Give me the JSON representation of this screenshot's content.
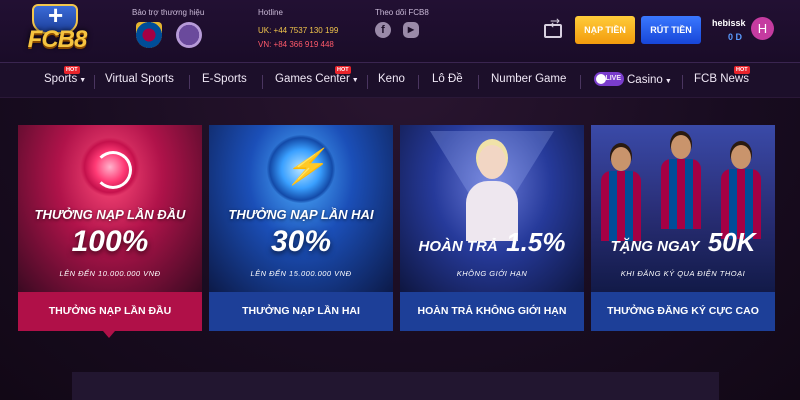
{
  "header": {
    "logo_text": "FCB8",
    "sponsor_label": "Bảo trợ thương hiệu",
    "hotline_label": "Hotline",
    "hotline_uk": "UK: +44 7537 130 199",
    "hotline_vn": "VN: +84 366 919 448",
    "follow_label": "Theo dõi FCB8",
    "social_icons": [
      "facebook-icon",
      "youtube-icon"
    ],
    "deposit_label": "NẠP TIỀN",
    "withdraw_label": "RÚT TIỀN",
    "username": "hebissk",
    "balance": "0 D",
    "avatar_initial": "H"
  },
  "nav": {
    "items": [
      {
        "label": "Sports",
        "hot": true,
        "dropdown": true
      },
      {
        "label": "Virtual Sports"
      },
      {
        "label": "E-Sports"
      },
      {
        "label": "Games Center",
        "hot": true,
        "dropdown": true
      },
      {
        "label": "Keno"
      },
      {
        "label": "Lô Đề"
      },
      {
        "label": "Number Game"
      },
      {
        "label": "Casino",
        "live": true,
        "dropdown": true
      },
      {
        "label": "FCB News",
        "hot": true
      }
    ],
    "hot_badge": "HOT",
    "live_badge": "LIVE"
  },
  "promos": [
    {
      "title": "THƯỞNG NẠP LẦN ĐẦU",
      "big": "100%",
      "sub": "LÊN ĐẾN 10.000.000 VNĐ",
      "tab": "THƯỞNG NẠP LẦN ĐẦU",
      "active": true
    },
    {
      "title": "THƯỞNG NẠP LẦN HAI",
      "big": "30%",
      "sub": "LÊN ĐẾN 15.000.000 VNĐ",
      "tab": "THƯỞNG NẠP LẦN HAI"
    },
    {
      "title": "HOÀN TRẢ",
      "big": "1.5%",
      "sub": "KHÔNG GIỚI HẠN",
      "tab": "HOÀN TRẢ KHÔNG GIỚI HẠN"
    },
    {
      "title": "TẶNG NGAY",
      "big": "50K",
      "sub": "KHI ĐĂNG KÝ QUA ĐIỆN THOẠI",
      "tab": "THƯỞNG ĐĂNG KÝ CỰC CAO"
    }
  ],
  "colors": {
    "gold": "#f6c440",
    "deposit": "#f39b0d",
    "withdraw": "#1746d8",
    "active_tab": "#b01048",
    "tab": "#1d3f98"
  }
}
